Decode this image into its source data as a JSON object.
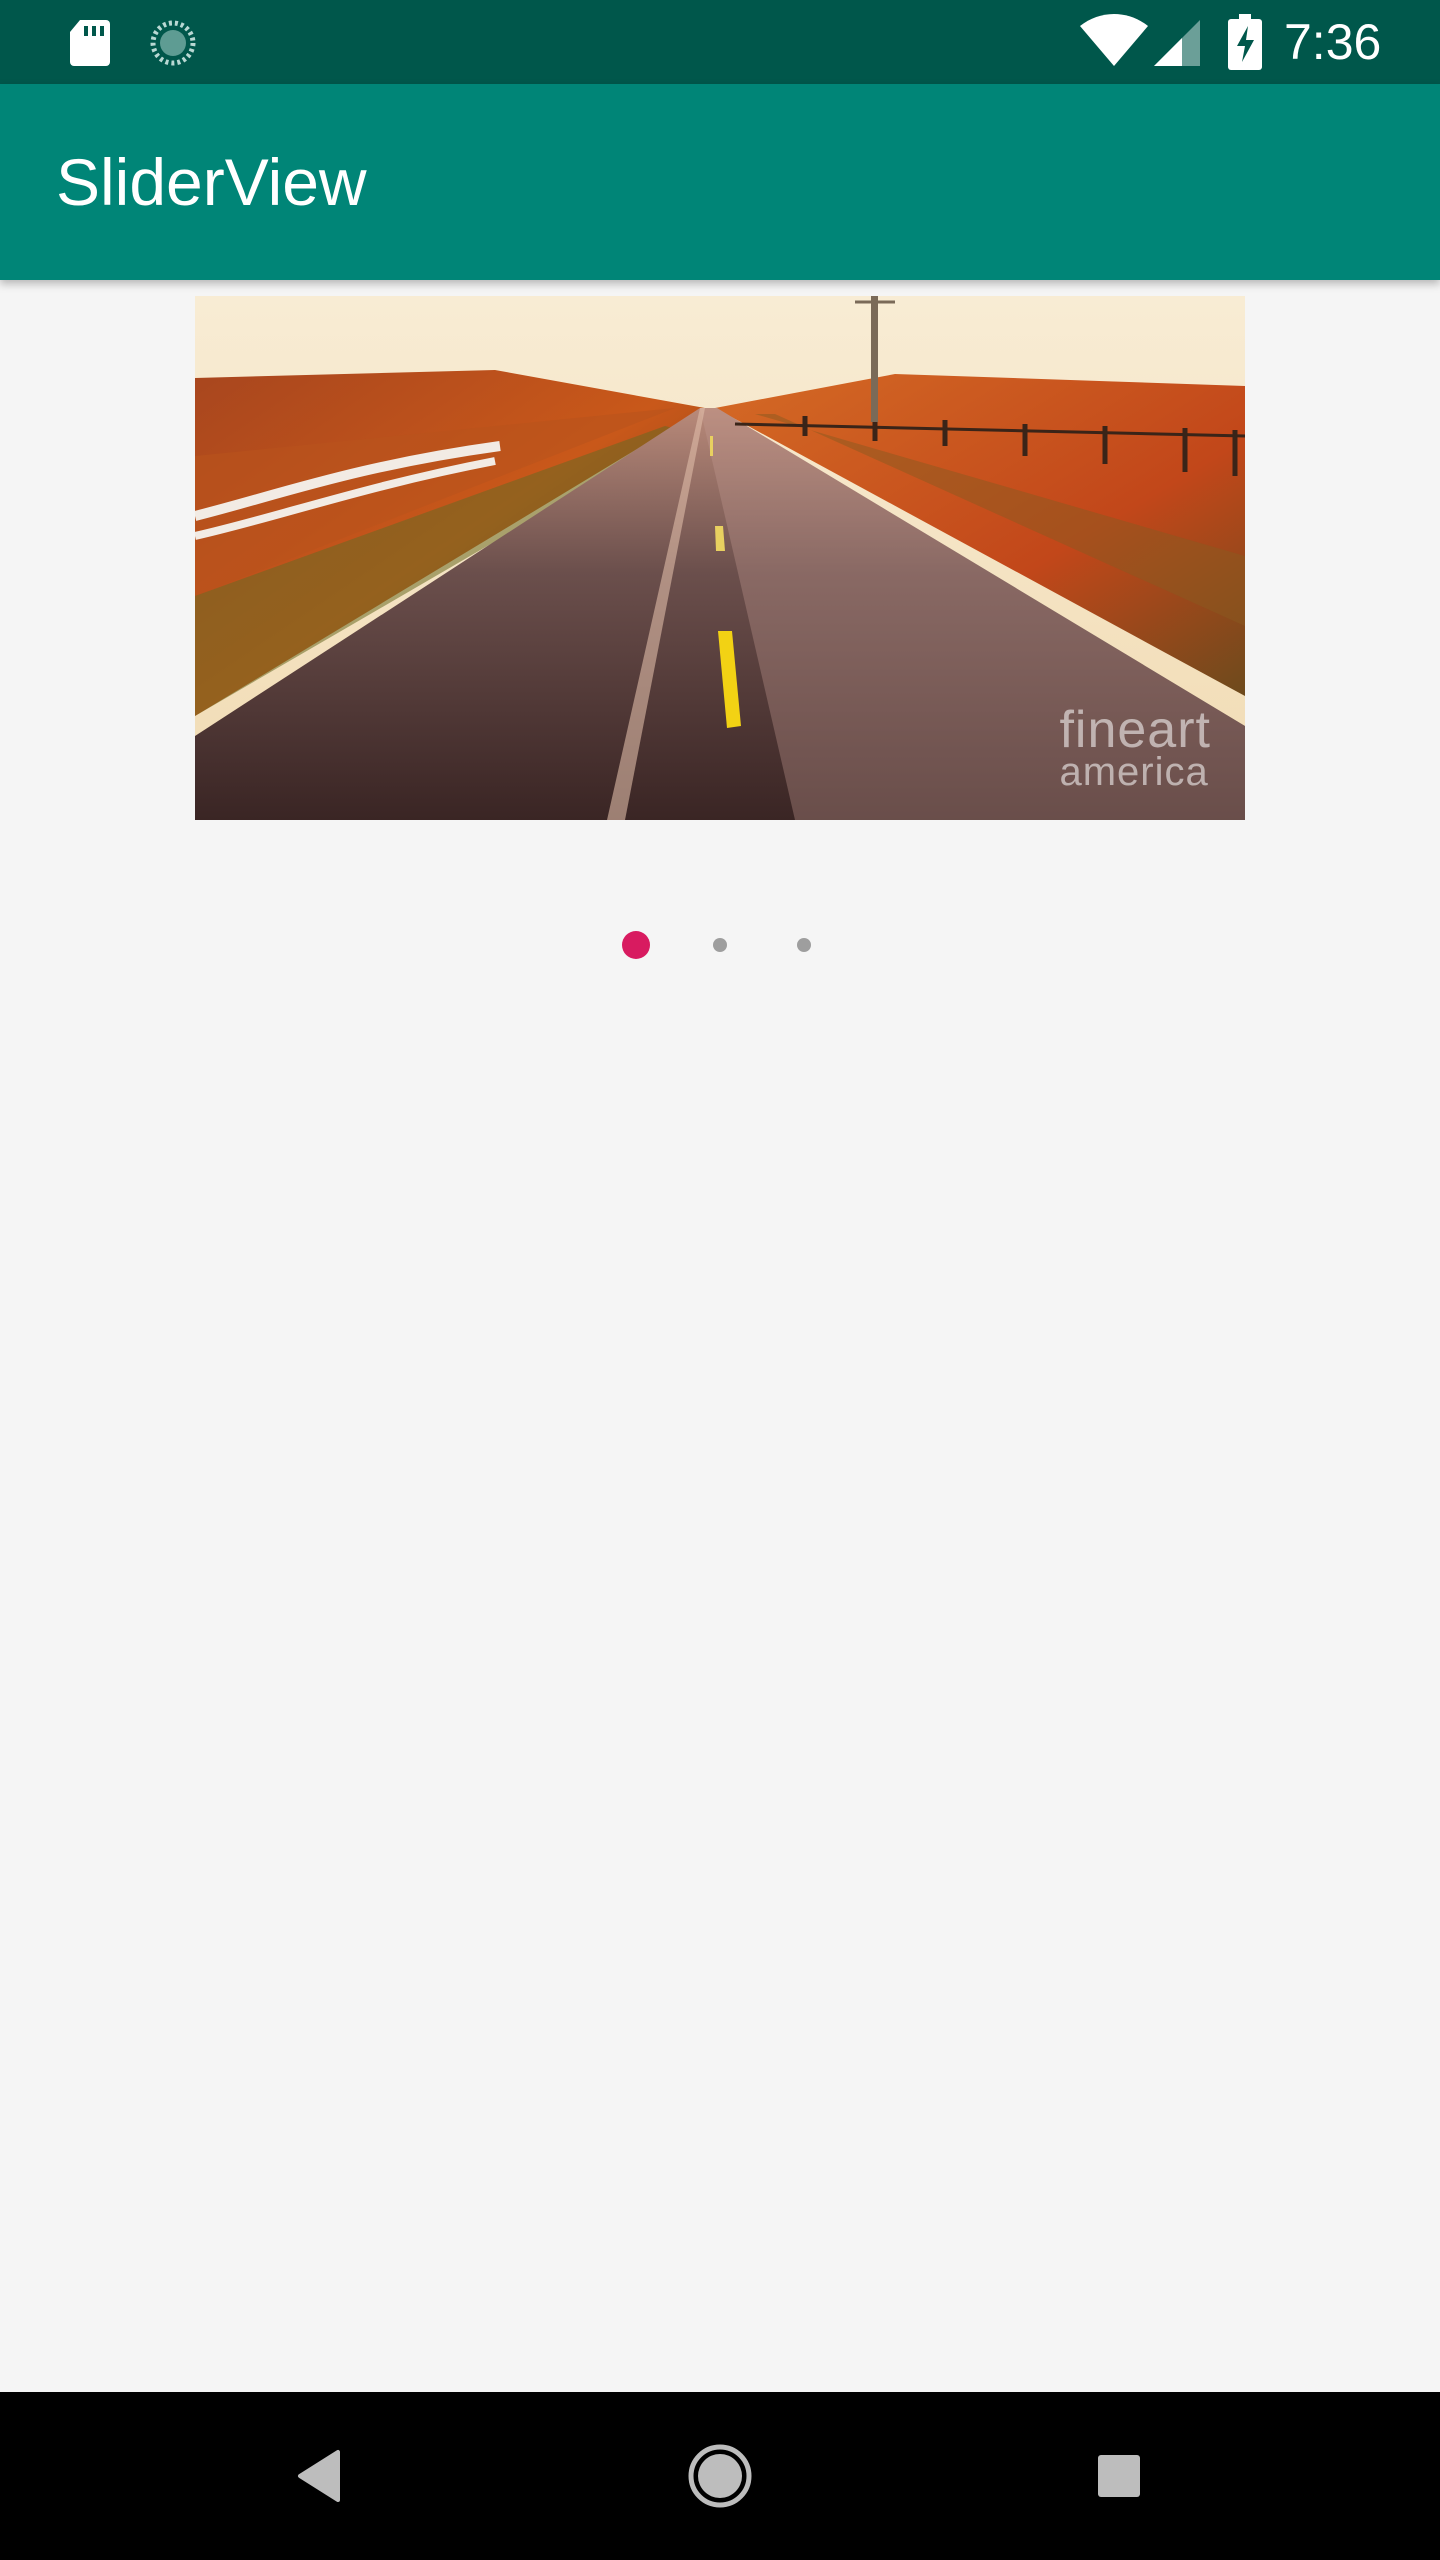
{
  "status_bar": {
    "time": "7:36",
    "icons": [
      "sd-card-icon",
      "sync-icon",
      "wifi-icon",
      "signal-icon",
      "battery-charging-icon"
    ]
  },
  "app_bar": {
    "title": "SliderView",
    "color": "#008577",
    "status_color": "#00574b"
  },
  "slider": {
    "current_slide": 1,
    "total_slides": 3,
    "image_description": "road",
    "watermark_line1": "fineart",
    "watermark_line2": "america"
  },
  "indicator": {
    "active_color": "#d81b60",
    "inactive_color": "#9e9e9e"
  },
  "nav_bar": {
    "buttons": [
      "back-icon",
      "home-icon",
      "recents-icon"
    ]
  }
}
